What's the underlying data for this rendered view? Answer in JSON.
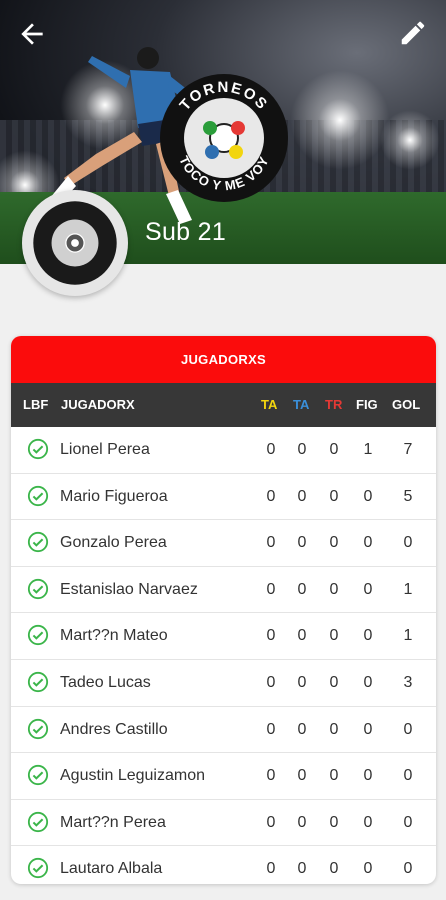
{
  "header": {
    "team_name": "Sub 21",
    "back_icon": "arrow-left-icon",
    "edit_icon": "pencil-icon",
    "logo_text_top": "TORNEOS",
    "logo_text_bottom": "TOCO Y ME VOY"
  },
  "table": {
    "title": "JUGADORXS",
    "columns": {
      "lbf": "LBF",
      "player": "JUGADORX",
      "ta_yellow": "TA",
      "ta_blue": "TA",
      "tr": "TR",
      "fig": "FIG",
      "gol": "GOL"
    },
    "rows": [
      {
        "name": "Lionel Perea",
        "ta": "0",
        "ta2": "0",
        "tr": "0",
        "fig": "1",
        "gol": "7"
      },
      {
        "name": "Mario Figueroa",
        "ta": "0",
        "ta2": "0",
        "tr": "0",
        "fig": "0",
        "gol": "5"
      },
      {
        "name": "Gonzalo Perea",
        "ta": "0",
        "ta2": "0",
        "tr": "0",
        "fig": "0",
        "gol": "0"
      },
      {
        "name": "Estanislao Narvaez",
        "ta": "0",
        "ta2": "0",
        "tr": "0",
        "fig": "0",
        "gol": "1"
      },
      {
        "name": "Mart??n Mateo",
        "ta": "0",
        "ta2": "0",
        "tr": "0",
        "fig": "0",
        "gol": "1"
      },
      {
        "name": "Tadeo Lucas",
        "ta": "0",
        "ta2": "0",
        "tr": "0",
        "fig": "0",
        "gol": "3"
      },
      {
        "name": "Andres Castillo",
        "ta": "0",
        "ta2": "0",
        "tr": "0",
        "fig": "0",
        "gol": "0"
      },
      {
        "name": "Agustin Leguizamon",
        "ta": "0",
        "ta2": "0",
        "tr": "0",
        "fig": "0",
        "gol": "0"
      },
      {
        "name": "Mart??n Perea",
        "ta": "0",
        "ta2": "0",
        "tr": "0",
        "fig": "0",
        "gol": "0"
      },
      {
        "name": "Lautaro Albala",
        "ta": "0",
        "ta2": "0",
        "tr": "0",
        "fig": "0",
        "gol": "0"
      }
    ]
  },
  "colors": {
    "accent_red": "#fb0c0c",
    "header_dark": "#373737",
    "ta_yellow": "#f2d50f",
    "ta_blue": "#3a8fd9",
    "tr_red": "#e53935",
    "check_green": "#3bb54a"
  }
}
